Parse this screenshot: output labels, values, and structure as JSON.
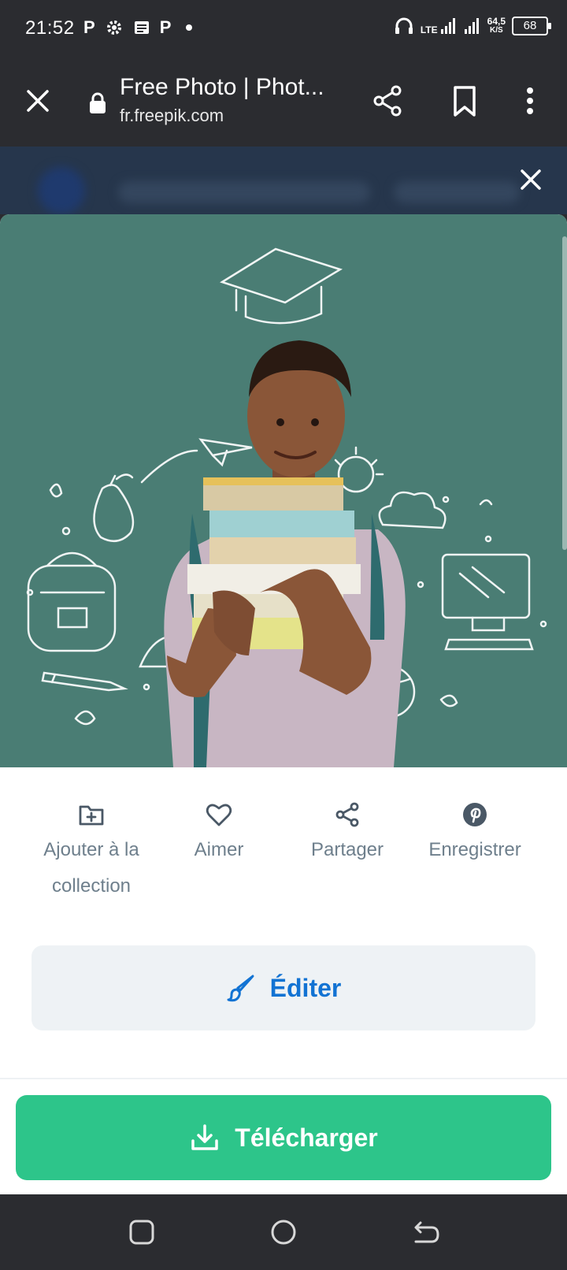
{
  "status_bar": {
    "time": "21:52",
    "left_icons": [
      "p-icon",
      "gear-icon",
      "news-icon",
      "p-icon",
      "dot-icon"
    ],
    "network_top": "LTE",
    "speed_value": "64,5",
    "speed_unit": "K/S",
    "battery": "68"
  },
  "toolbar": {
    "title": "Free Photo | Phot...",
    "url": "fr.freepik.com"
  },
  "photo": {
    "description_alt": "Free Photo"
  },
  "actions": [
    {
      "label": "Ajouter à la collection",
      "icon": "folder-plus-icon"
    },
    {
      "label": "Aimer",
      "icon": "heart-icon"
    },
    {
      "label": "Partager",
      "icon": "share-icon"
    },
    {
      "label": "Enregistrer",
      "icon": "pinterest-icon"
    }
  ],
  "edit": {
    "label": "Éditer",
    "icon": "brush-icon"
  },
  "download": {
    "label": "Télécharger",
    "icon": "download-icon"
  },
  "colors": {
    "chrome": "#2b2c30",
    "accent_blue": "#1273d3",
    "download_green": "#2dc58a",
    "chalkboard": "#4a7d74"
  }
}
